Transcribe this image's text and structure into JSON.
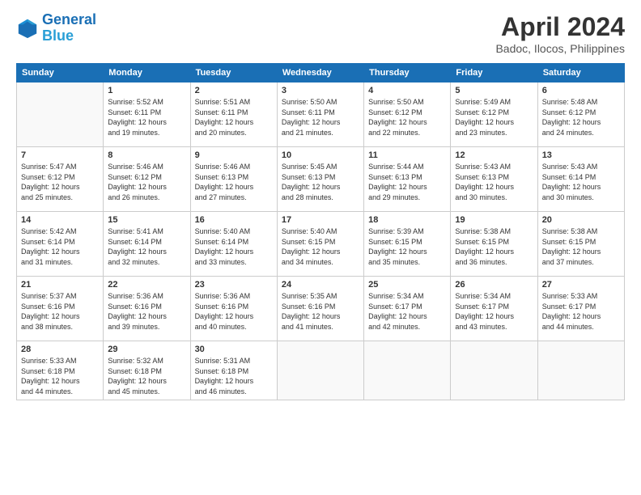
{
  "header": {
    "logo_line1": "General",
    "logo_line2": "Blue",
    "title": "April 2024",
    "subtitle": "Badoc, Ilocos, Philippines"
  },
  "weekdays": [
    "Sunday",
    "Monday",
    "Tuesday",
    "Wednesday",
    "Thursday",
    "Friday",
    "Saturday"
  ],
  "weeks": [
    [
      {
        "day": "",
        "info": ""
      },
      {
        "day": "1",
        "info": "Sunrise: 5:52 AM\nSunset: 6:11 PM\nDaylight: 12 hours\nand 19 minutes."
      },
      {
        "day": "2",
        "info": "Sunrise: 5:51 AM\nSunset: 6:11 PM\nDaylight: 12 hours\nand 20 minutes."
      },
      {
        "day": "3",
        "info": "Sunrise: 5:50 AM\nSunset: 6:11 PM\nDaylight: 12 hours\nand 21 minutes."
      },
      {
        "day": "4",
        "info": "Sunrise: 5:50 AM\nSunset: 6:12 PM\nDaylight: 12 hours\nand 22 minutes."
      },
      {
        "day": "5",
        "info": "Sunrise: 5:49 AM\nSunset: 6:12 PM\nDaylight: 12 hours\nand 23 minutes."
      },
      {
        "day": "6",
        "info": "Sunrise: 5:48 AM\nSunset: 6:12 PM\nDaylight: 12 hours\nand 24 minutes."
      }
    ],
    [
      {
        "day": "7",
        "info": "Sunrise: 5:47 AM\nSunset: 6:12 PM\nDaylight: 12 hours\nand 25 minutes."
      },
      {
        "day": "8",
        "info": "Sunrise: 5:46 AM\nSunset: 6:12 PM\nDaylight: 12 hours\nand 26 minutes."
      },
      {
        "day": "9",
        "info": "Sunrise: 5:46 AM\nSunset: 6:13 PM\nDaylight: 12 hours\nand 27 minutes."
      },
      {
        "day": "10",
        "info": "Sunrise: 5:45 AM\nSunset: 6:13 PM\nDaylight: 12 hours\nand 28 minutes."
      },
      {
        "day": "11",
        "info": "Sunrise: 5:44 AM\nSunset: 6:13 PM\nDaylight: 12 hours\nand 29 minutes."
      },
      {
        "day": "12",
        "info": "Sunrise: 5:43 AM\nSunset: 6:13 PM\nDaylight: 12 hours\nand 30 minutes."
      },
      {
        "day": "13",
        "info": "Sunrise: 5:43 AM\nSunset: 6:14 PM\nDaylight: 12 hours\nand 30 minutes."
      }
    ],
    [
      {
        "day": "14",
        "info": "Sunrise: 5:42 AM\nSunset: 6:14 PM\nDaylight: 12 hours\nand 31 minutes."
      },
      {
        "day": "15",
        "info": "Sunrise: 5:41 AM\nSunset: 6:14 PM\nDaylight: 12 hours\nand 32 minutes."
      },
      {
        "day": "16",
        "info": "Sunrise: 5:40 AM\nSunset: 6:14 PM\nDaylight: 12 hours\nand 33 minutes."
      },
      {
        "day": "17",
        "info": "Sunrise: 5:40 AM\nSunset: 6:15 PM\nDaylight: 12 hours\nand 34 minutes."
      },
      {
        "day": "18",
        "info": "Sunrise: 5:39 AM\nSunset: 6:15 PM\nDaylight: 12 hours\nand 35 minutes."
      },
      {
        "day": "19",
        "info": "Sunrise: 5:38 AM\nSunset: 6:15 PM\nDaylight: 12 hours\nand 36 minutes."
      },
      {
        "day": "20",
        "info": "Sunrise: 5:38 AM\nSunset: 6:15 PM\nDaylight: 12 hours\nand 37 minutes."
      }
    ],
    [
      {
        "day": "21",
        "info": "Sunrise: 5:37 AM\nSunset: 6:16 PM\nDaylight: 12 hours\nand 38 minutes."
      },
      {
        "day": "22",
        "info": "Sunrise: 5:36 AM\nSunset: 6:16 PM\nDaylight: 12 hours\nand 39 minutes."
      },
      {
        "day": "23",
        "info": "Sunrise: 5:36 AM\nSunset: 6:16 PM\nDaylight: 12 hours\nand 40 minutes."
      },
      {
        "day": "24",
        "info": "Sunrise: 5:35 AM\nSunset: 6:16 PM\nDaylight: 12 hours\nand 41 minutes."
      },
      {
        "day": "25",
        "info": "Sunrise: 5:34 AM\nSunset: 6:17 PM\nDaylight: 12 hours\nand 42 minutes."
      },
      {
        "day": "26",
        "info": "Sunrise: 5:34 AM\nSunset: 6:17 PM\nDaylight: 12 hours\nand 43 minutes."
      },
      {
        "day": "27",
        "info": "Sunrise: 5:33 AM\nSunset: 6:17 PM\nDaylight: 12 hours\nand 44 minutes."
      }
    ],
    [
      {
        "day": "28",
        "info": "Sunrise: 5:33 AM\nSunset: 6:18 PM\nDaylight: 12 hours\nand 44 minutes."
      },
      {
        "day": "29",
        "info": "Sunrise: 5:32 AM\nSunset: 6:18 PM\nDaylight: 12 hours\nand 45 minutes."
      },
      {
        "day": "30",
        "info": "Sunrise: 5:31 AM\nSunset: 6:18 PM\nDaylight: 12 hours\nand 46 minutes."
      },
      {
        "day": "",
        "info": ""
      },
      {
        "day": "",
        "info": ""
      },
      {
        "day": "",
        "info": ""
      },
      {
        "day": "",
        "info": ""
      }
    ]
  ]
}
